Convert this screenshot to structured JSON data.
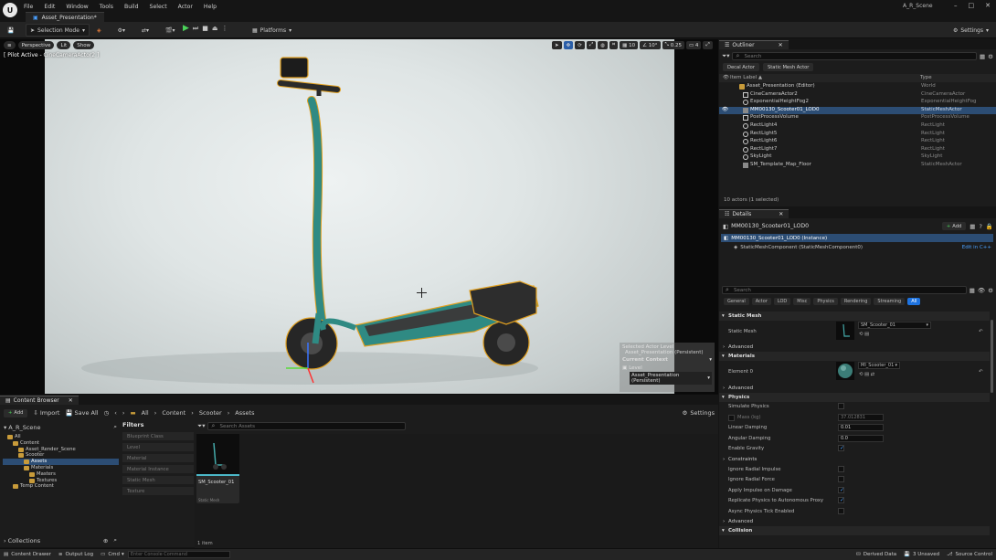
{
  "titlebar": {
    "menu": [
      "File",
      "Edit",
      "Window",
      "Tools",
      "Build",
      "Select",
      "Actor",
      "Help"
    ],
    "doc_tab": "Asset_Presentation*",
    "project": "A_R_Scene"
  },
  "toolbar": {
    "selection_mode": "Selection Mode",
    "platforms": "Platforms",
    "settings": "Settings"
  },
  "viewport": {
    "perspective": "Perspective",
    "lit": "Lit",
    "show": "Show",
    "pilot_label": "[ Pilot Active - CineCameraActor2 ]",
    "grid_snap": "10",
    "rot_snap": "10°",
    "scale_snap": "0.25",
    "cam_speed": "4",
    "level_popup": {
      "selected_actor_label": "Selected Actor Level",
      "selected_actor_value": "Asset_Presentation (Persistent)",
      "current_context": "Current Context",
      "level_label": "Level",
      "level_value": "Asset_Presentation (Persistent)"
    }
  },
  "outliner": {
    "tab": "Outliner",
    "search_placeholder": "Search",
    "chips": [
      "Decal Actor",
      "Static Mesh Actor"
    ],
    "col_label": "Item Label ▲",
    "col_type": "Type",
    "rows": [
      {
        "name": "Asset_Presentation (Editor)",
        "type": "World",
        "icon": "folder-icon"
      },
      {
        "name": "CineCameraActor2",
        "type": "CineCameraActor",
        "icon": "camera-icon"
      },
      {
        "name": "ExponentialHeightFog2",
        "type": "ExponentialHeightFog",
        "icon": "fog-icon"
      },
      {
        "name": "MM00130_Scooter01_LOD0",
        "type": "StaticMeshActor",
        "icon": "mesh-icon"
      },
      {
        "name": "PostProcessVolume",
        "type": "PostProcessVolume",
        "icon": "volume-icon"
      },
      {
        "name": "RectLight4",
        "type": "RectLight",
        "icon": "light-icon"
      },
      {
        "name": "RectLight5",
        "type": "RectLight",
        "icon": "light-icon"
      },
      {
        "name": "RectLight6",
        "type": "RectLight",
        "icon": "light-icon"
      },
      {
        "name": "RectLight7",
        "type": "RectLight",
        "icon": "light-icon"
      },
      {
        "name": "SkyLight",
        "type": "SkyLight",
        "icon": "light-icon"
      },
      {
        "name": "SM_Template_Map_Floor",
        "type": "StaticMeshActor",
        "icon": "mesh-icon"
      }
    ],
    "footer": "10 actors (1 selected)"
  },
  "details": {
    "tab": "Details",
    "object_name": "MM00130_Scooter01_LOD0",
    "add": "Add",
    "instance_row": "MM00130_Scooter01_LOD0 (Instance)",
    "component_row": "StaticMeshComponent (StaticMeshComponent0)",
    "edit_cpp": "Edit in C++",
    "search_placeholder": "Search",
    "filters": [
      "General",
      "Actor",
      "LOD",
      "Misc",
      "Physics",
      "Rendering",
      "Streaming",
      "All"
    ],
    "static_mesh_section": "Static Mesh",
    "static_mesh_label": "Static Mesh",
    "static_mesh_value": "SM_Scooter_01",
    "advanced": "Advanced",
    "materials_section": "Materials",
    "element0_label": "Element 0",
    "element0_value": "MI_Scooter_01",
    "physics_section": "Physics",
    "simulate_physics": "Simulate Physics",
    "mass_kg": "Mass (kg)",
    "mass_value": "37.012831",
    "linear_damping": "Linear Damping",
    "linear_damping_value": "0.01",
    "angular_damping": "Angular Damping",
    "angular_damping_value": "0.0",
    "enable_gravity": "Enable Gravity",
    "constraints": "Constraints",
    "ignore_radial_impulse": "Ignore Radial Impulse",
    "ignore_radial_force": "Ignore Radial Force",
    "apply_impulse_damage": "Apply Impulse on Damage",
    "replicate_physics": "Replicate Physics to Autonomous Proxy",
    "async_tick": "Async Physics Tick Enabled",
    "collision_section": "Collision"
  },
  "content_browser": {
    "tab": "Content Browser",
    "add": "Add",
    "import": "Import",
    "save_all": "Save All",
    "breadcrumb": [
      "All",
      "Content",
      "Scooter",
      "Assets"
    ],
    "settings": "Settings",
    "project_root": "A_R_Scene",
    "folders": [
      {
        "name": "All",
        "depth": 0
      },
      {
        "name": "Content",
        "depth": 1
      },
      {
        "name": "Asset_Render_Scene",
        "depth": 2
      },
      {
        "name": "Scooter",
        "depth": 2
      },
      {
        "name": "Assets",
        "depth": 3,
        "selected": true
      },
      {
        "name": "Materials",
        "depth": 3
      },
      {
        "name": "Masters",
        "depth": 4
      },
      {
        "name": "Textures",
        "depth": 4
      },
      {
        "name": "Temp Content",
        "depth": 1
      }
    ],
    "filters_title": "Filters",
    "filter_items": [
      "Blueprint Class",
      "Level",
      "Material",
      "Material Instance",
      "Static Mesh",
      "Texture"
    ],
    "search_placeholder": "Search Assets",
    "asset_name": "SM_Scooter_01",
    "asset_type": "Static Mesh",
    "item_count": "1 item",
    "collections": "Collections"
  },
  "statusbar": {
    "content_drawer": "Content Drawer",
    "output_log": "Output Log",
    "cmd": "Cmd",
    "cmd_placeholder": "Enter Console Command",
    "derived_data": "Derived Data",
    "unsaved": "3 Unsaved",
    "source_control": "Source Control"
  },
  "colors": {
    "accent": "#1e73e0",
    "selection": "#2c4d74",
    "scooter_teal": "#2f8a83",
    "play_green": "#4bd35a"
  }
}
